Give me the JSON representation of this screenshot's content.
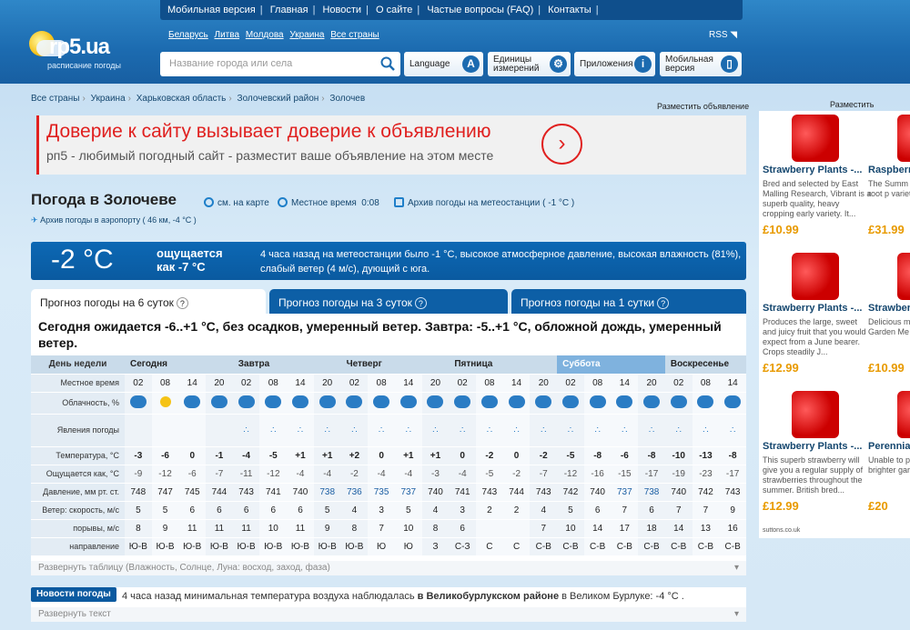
{
  "nav": {
    "items": [
      "Мобильная версия",
      "Главная",
      "Новости",
      "О сайте",
      "Частые вопросы (FAQ)",
      "Контакты"
    ]
  },
  "logo": {
    "brand": "rp5.ua",
    "tagline": "расписание погоды"
  },
  "countries": [
    "Беларусь",
    "Литва",
    "Молдова",
    "Украина",
    "Все страны"
  ],
  "rss": "RSS",
  "search": {
    "placeholder": "Название города или села"
  },
  "buttons": {
    "language": "Language",
    "units": "Единицы измерений",
    "apps": "Приложения",
    "mobile": "Мобильная версия"
  },
  "breadcrumb": [
    "Все страны",
    "Украина",
    "Харьковская область",
    "Золочевский район",
    "Золочев"
  ],
  "place_ad": "Разместить объявление",
  "ad": {
    "headline": "Доверие к сайту вызывает доверие к объявлению",
    "sub": "рп5 - любимый погодный сайт - разместит ваше объявление на этом месте"
  },
  "title": "Погода в Золочеве",
  "meta": {
    "map": "см. на карте",
    "local_time": "Местное время",
    "time": "0:08",
    "archive": "Архив погоды на метеостанции ( -1 °C )",
    "airport": "Архив погоды в аэропорту ( 46 км, -4 °C )"
  },
  "now": {
    "temp": "-2 °C",
    "feels1": "ощущается",
    "feels2": "как -7 °C",
    "desc": "4 часа назад на метеостанции было -1 °C, высокое атмосферное давление, высокая влажность (81%), слабый ветер (4 м/с), дующий с юга."
  },
  "tabs": [
    "Прогноз погоды на 6 суток",
    "Прогноз погоды на 3 суток",
    "Прогноз погоды на 1 сутки"
  ],
  "summary": "Сегодня ожидается -6..+1 °C, без осадков, умеренный ветер. Завтра: -5..+1 °C, обложной дождь, умеренный ветер.",
  "grid": {
    "labels": {
      "day": "День недели",
      "time": "Местное время",
      "clouds": "Облачность, %",
      "phen": "Явления погоды",
      "temp": "Температура, °C",
      "feels": "Ощущается как, °C",
      "press": "Давление, мм рт. ст.",
      "wind": "Ветер: скорость, м/с",
      "gusts": "порывы, м/с",
      "dir": "направление"
    },
    "days": [
      "Сегодня",
      "Завтра",
      "Четверг",
      "Пятница",
      "Суббота",
      "Воскресенье"
    ],
    "times": [
      "02",
      "08",
      "14",
      "20",
      "02",
      "08",
      "14",
      "20",
      "02",
      "08",
      "14",
      "20",
      "02",
      "08",
      "14",
      "20",
      "02",
      "08",
      "14",
      "20",
      "02",
      "08",
      "14"
    ],
    "temp": [
      "-3",
      "-6",
      "0",
      "-1",
      "-4",
      "-5",
      "+1",
      "+1",
      "+2",
      "0",
      "+1",
      "+1",
      "0",
      "-2",
      "0",
      "-2",
      "-5",
      "-8",
      "-6",
      "-8",
      "-10",
      "-13",
      "-8"
    ],
    "feels": [
      "-9",
      "-12",
      "-6",
      "-7",
      "-11",
      "-12",
      "-4",
      "-4",
      "-2",
      "-4",
      "-4",
      "-3",
      "-4",
      "-5",
      "-2",
      "-7",
      "-12",
      "-16",
      "-15",
      "-17",
      "-19",
      "-23",
      "-17"
    ],
    "press": [
      "748",
      "747",
      "745",
      "744",
      "743",
      "741",
      "740",
      "738",
      "736",
      "735",
      "737",
      "740",
      "741",
      "743",
      "744",
      "743",
      "742",
      "740",
      "737",
      "738",
      "740",
      "742",
      "743"
    ],
    "wind": [
      "5",
      "5",
      "6",
      "6",
      "6",
      "6",
      "6",
      "5",
      "4",
      "3",
      "5",
      "4",
      "3",
      "2",
      "2",
      "4",
      "5",
      "6",
      "7",
      "6",
      "7",
      "7",
      "9"
    ],
    "gusts": [
      "8",
      "9",
      "11",
      "11",
      "11",
      "10",
      "11",
      "9",
      "8",
      "7",
      "10",
      "8",
      "6",
      "",
      "",
      "7",
      "10",
      "14",
      "17",
      "18",
      "14",
      "13",
      "16"
    ],
    "dir": [
      "Ю-В",
      "Ю-В",
      "Ю-В",
      "Ю-В",
      "Ю-В",
      "Ю-В",
      "Ю-В",
      "Ю-В",
      "Ю-В",
      "Ю",
      "Ю",
      "З",
      "С-З",
      "С",
      "С",
      "С-В",
      "С-В",
      "С-В",
      "С-В",
      "С-В",
      "С-В",
      "С-В",
      "С-В"
    ]
  },
  "expand": "Развернуть таблицу (Влажность, Солнце, Луна: восход, заход, фаза)",
  "news": {
    "label": "Новости погоды",
    "text": "4 часа назад минимальная температура воздуха наблюдалась",
    "bold": "в Великобурлукском районе",
    "tail": "в Великом Бурлуке: -4 °C ."
  },
  "expand2": "Развернуть текст",
  "side": {
    "head": "Разместить",
    "footer": "suttons.co.uk",
    "products": [
      {
        "name": "Strawberry Plants -...",
        "desc": "Bred and selected by East Malling Research, Vibrant is a superb quality, heavy cropping early variety. It...",
        "price": "£10.99"
      },
      {
        "name": "Raspberr",
        "desc": "The Summ Collection bare root p variety):Ma",
        "price": "£31.99"
      },
      {
        "name": "Strawberry Plants -...",
        "desc": "Produces the large, sweet and juicy fruit that you would expect from a June bearer. Crops steadily J...",
        "price": "£12.99"
      },
      {
        "name": "Strawber",
        "desc": "Delicious m perfect for Garden Me",
        "price": "£10.99"
      },
      {
        "name": "Strawberry Plants -...",
        "desc": "This superb strawberry will give you a regular supply of strawberries throughout the summer. British bred...",
        "price": "£12.99"
      },
      {
        "name": "Perennia",
        "desc": "Unable to perennial p for brighter garden or p",
        "price": "£20"
      }
    ]
  }
}
